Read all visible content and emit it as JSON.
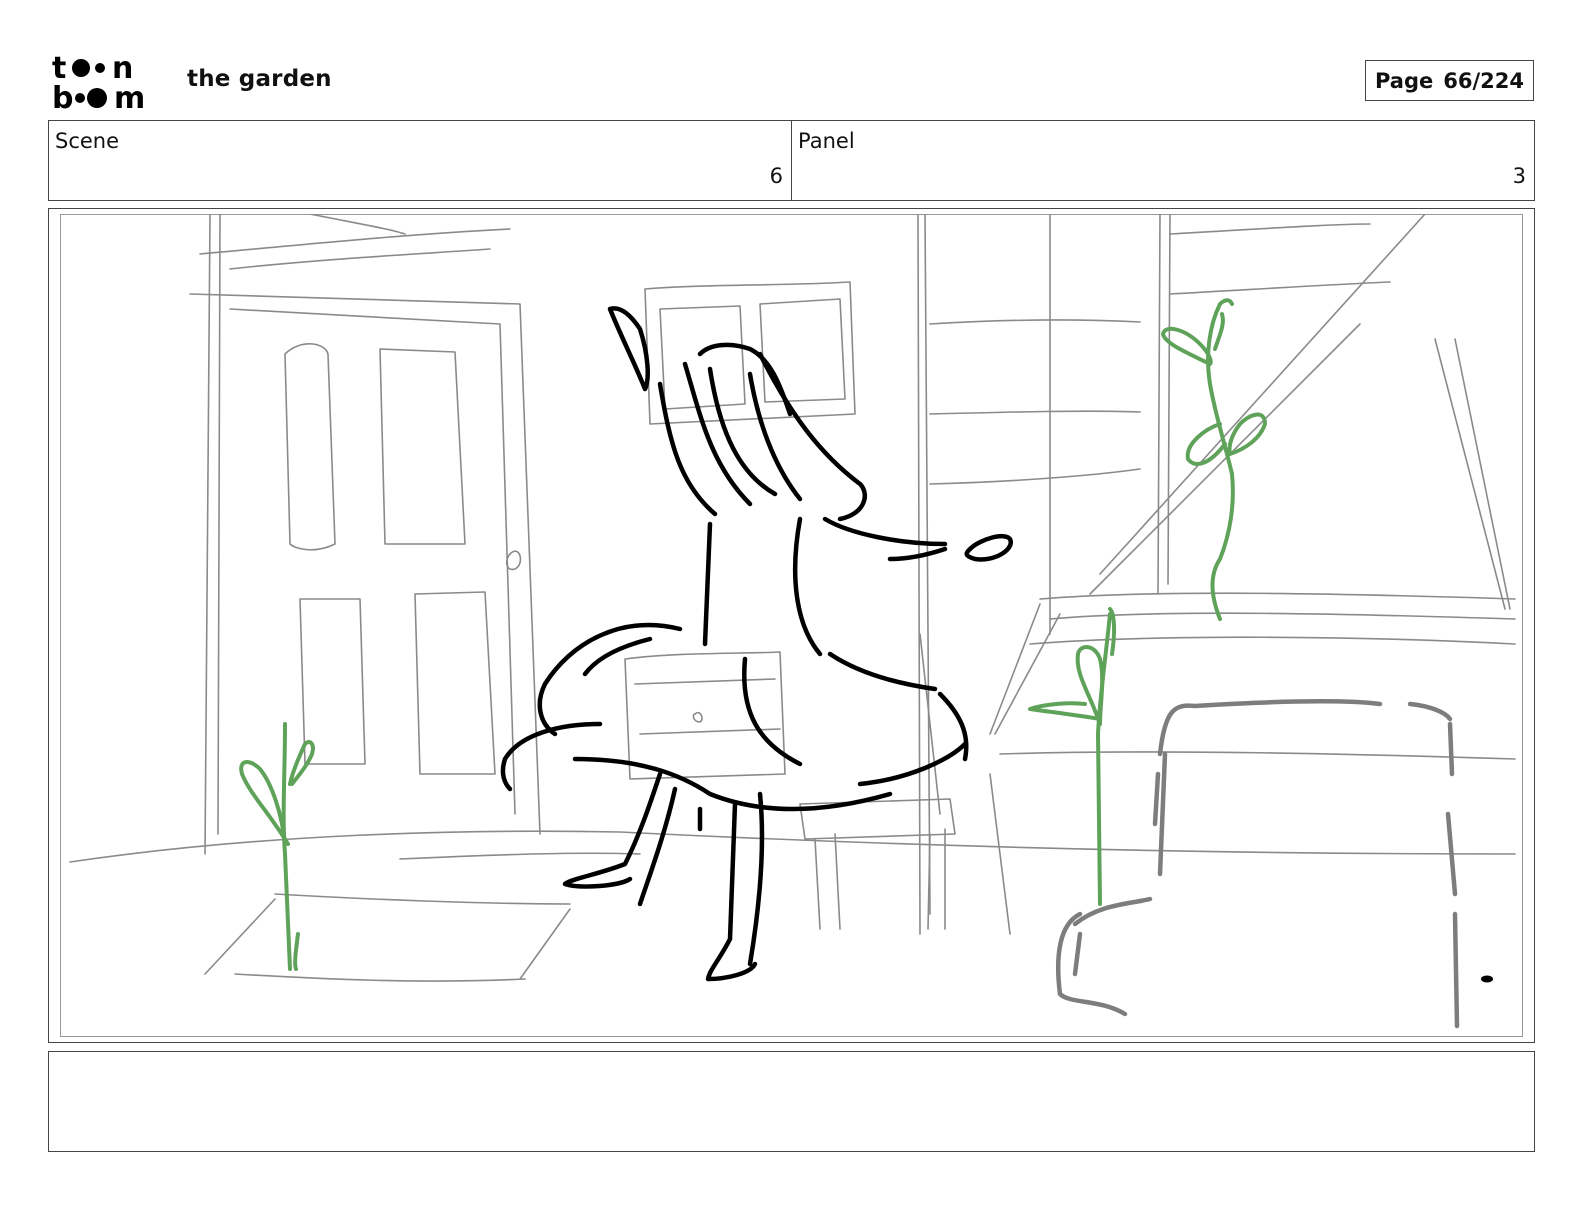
{
  "header": {
    "logo_text": "toon boom",
    "project_title": "the garden",
    "page_label": "Page",
    "page_value": "66/224"
  },
  "info": {
    "scene_label": "Scene",
    "scene_value": "6",
    "panel_label": "Panel",
    "panel_value": "3"
  },
  "caption": {
    "text": ""
  },
  "colors": {
    "sketch_gray": "#8a8a8a",
    "ink_black": "#000000",
    "plant_green": "#5fa35a",
    "border": "#444444"
  }
}
